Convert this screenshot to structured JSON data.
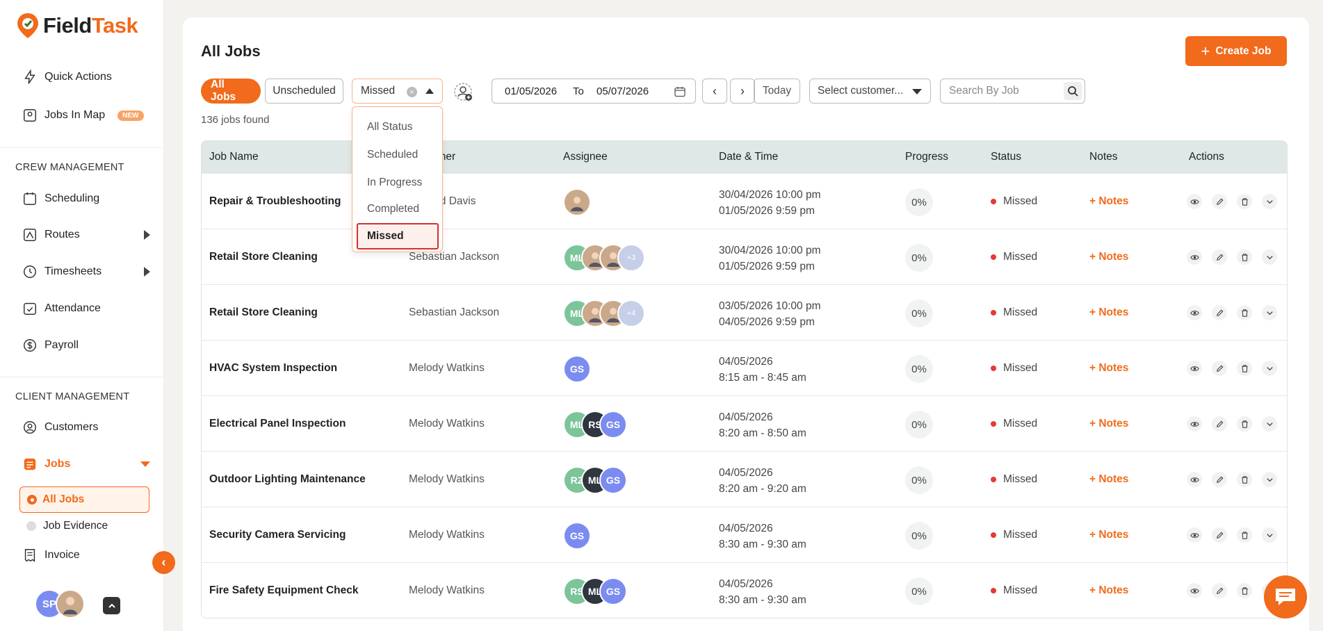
{
  "app": {
    "logo_prefix": "Field",
    "logo_suffix": "Task",
    "brand_color": "#f26a1b"
  },
  "sidebar": {
    "quick_actions": "Quick Actions",
    "jobs_in_map": "Jobs In Map",
    "new_badge": "NEW",
    "crew_label": "CREW MANAGEMENT",
    "scheduling": "Scheduling",
    "routes": "Routes",
    "timesheets": "Timesheets",
    "attendance": "Attendance",
    "payroll": "Payroll",
    "client_label": "CLIENT MANAGEMENT",
    "customers": "Customers",
    "jobs": "Jobs",
    "all_jobs": "All Jobs",
    "job_evidence": "Job Evidence",
    "invoice": "Invoice",
    "user_initials": "SP"
  },
  "main": {
    "title": "All Jobs",
    "create_button": "Create Job",
    "chip_all": "All Jobs",
    "chip_unscheduled": "Unscheduled",
    "status_value": "Missed",
    "date_from": "01/05/2026",
    "date_to_label": "To",
    "date_to": "05/07/2026",
    "today": "Today",
    "customer_placeholder": "Select customer...",
    "search_placeholder": "Search By Job",
    "jobs_found": "136 jobs found"
  },
  "dropdown": {
    "options": [
      "All Status",
      "Scheduled",
      "In Progress",
      "Completed",
      "Missed"
    ]
  },
  "table": {
    "headers": [
      "Job Name",
      "Customer",
      "Assignee",
      "Date & Time",
      "Progress",
      "Status",
      "Notes",
      "Actions"
    ],
    "rows": [
      {
        "job": "Repair & Troubleshooting",
        "customer": "Richard Davis",
        "dt1": "30/04/2026 10:00 pm",
        "dt2": "01/05/2026 9:59 pm",
        "progress": "0%",
        "status": "Missed",
        "notes": "+ Notes"
      },
      {
        "job": "Retail Store Cleaning",
        "customer": "Sebastian Jackson",
        "dt1": "30/04/2026 10:00 pm",
        "dt2": "01/05/2026 9:59 pm",
        "progress": "0%",
        "status": "Missed",
        "notes": "+ Notes",
        "more": "+3"
      },
      {
        "job": "Retail Store Cleaning",
        "customer": "Sebastian Jackson",
        "dt1": "03/05/2026 10:00 pm",
        "dt2": "04/05/2026 9:59 pm",
        "progress": "0%",
        "status": "Missed",
        "notes": "+ Notes",
        "more": "+4"
      },
      {
        "job": "HVAC System Inspection",
        "customer": "Melody Watkins",
        "dt1": "04/05/2026",
        "dt2": "8:15 am - 8:45 am",
        "progress": "0%",
        "status": "Missed",
        "notes": "+ Notes"
      },
      {
        "job": "Electrical Panel Inspection",
        "customer": "Melody Watkins",
        "dt1": "04/05/2026",
        "dt2": "8:20 am - 8:50 am",
        "progress": "0%",
        "status": "Missed",
        "notes": "+ Notes"
      },
      {
        "job": "Outdoor Lighting Maintenance",
        "customer": "Melody Watkins",
        "dt1": "04/05/2026",
        "dt2": "8:20 am - 9:20 am",
        "progress": "0%",
        "status": "Missed",
        "notes": "+ Notes"
      },
      {
        "job": "Security Camera Servicing",
        "customer": "Melody Watkins",
        "dt1": "04/05/2026",
        "dt2": "8:30 am - 9:30 am",
        "progress": "0%",
        "status": "Missed",
        "notes": "+ Notes"
      },
      {
        "job": "Fire Safety Equipment Check",
        "customer": "Melody Watkins",
        "dt1": "04/05/2026",
        "dt2": "8:30 am - 9:30 am",
        "progress": "0%",
        "status": "Missed",
        "notes": "+ Notes"
      }
    ],
    "initials": {
      "ml": "ML",
      "gs": "GS",
      "rs": "RS",
      "rz": "RZ"
    }
  }
}
